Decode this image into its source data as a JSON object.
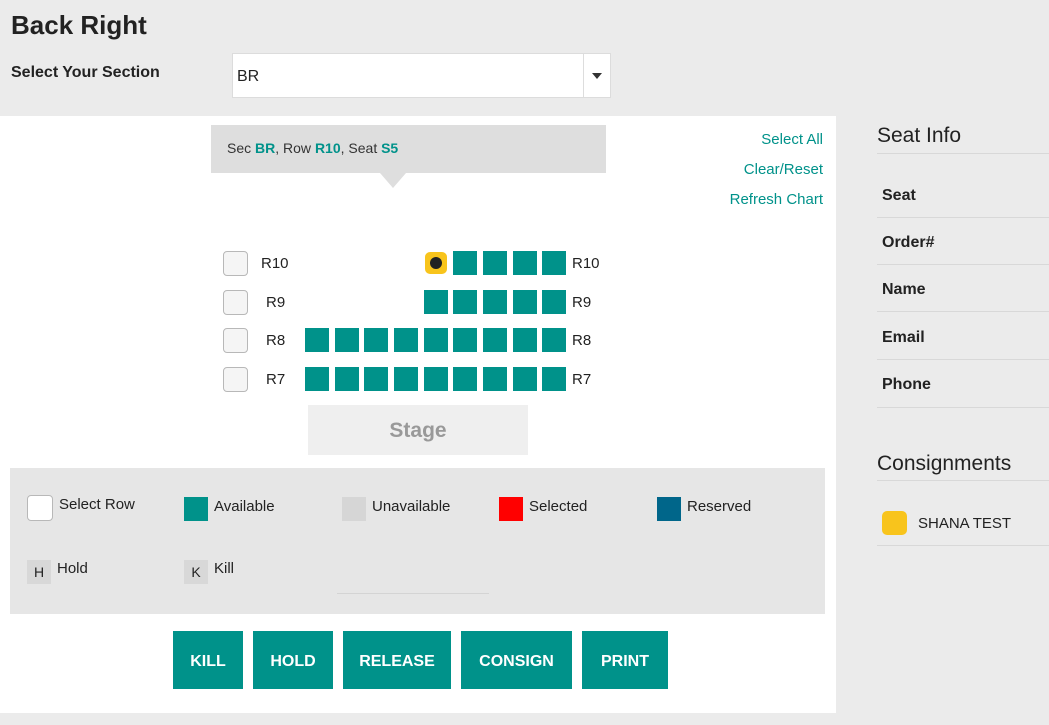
{
  "header": {
    "title": "Back Right",
    "section_label": "Select Your Section",
    "section_value": "BR"
  },
  "tooltip": {
    "sec_prefix": "Sec ",
    "sec": "BR",
    "row_prefix": ", Row ",
    "row": "R10",
    "seat_prefix": ", Seat ",
    "seat": "S5"
  },
  "actions": {
    "select_all": "Select All",
    "clear_reset": "Clear/Reset",
    "refresh": "Refresh Chart"
  },
  "rows": [
    {
      "label": "R10",
      "seats": 5,
      "first_seat_consigned": true
    },
    {
      "label": "R9",
      "seats": 5
    },
    {
      "label": "R8",
      "seats": 9
    },
    {
      "label": "R7",
      "seats": 9
    }
  ],
  "stage": "Stage",
  "legend": {
    "select_row": "Select Row",
    "available": "Available",
    "unavailable": "Unavailable",
    "selected": "Selected",
    "reserved": "Reserved",
    "hold_letter": "H",
    "hold": "Hold",
    "kill_letter": "K",
    "kill": "Kill"
  },
  "buttons": {
    "kill": "KILL",
    "hold": "HOLD",
    "release": "RELEASE",
    "consign": "CONSIGN",
    "print": "PRINT"
  },
  "seat_info": {
    "title": "Seat Info",
    "fields": [
      "Seat",
      "Order#",
      "Name",
      "Email",
      "Phone"
    ]
  },
  "consignments": {
    "title": "Consignments",
    "items": [
      "SHANA TEST"
    ]
  },
  "colors": {
    "accent": "#00928a",
    "available": "#00928a",
    "unavailable": "#d6d6d6",
    "selected": "#ff0000",
    "reserved": "#00668a",
    "consigned": "#f8c41c"
  }
}
